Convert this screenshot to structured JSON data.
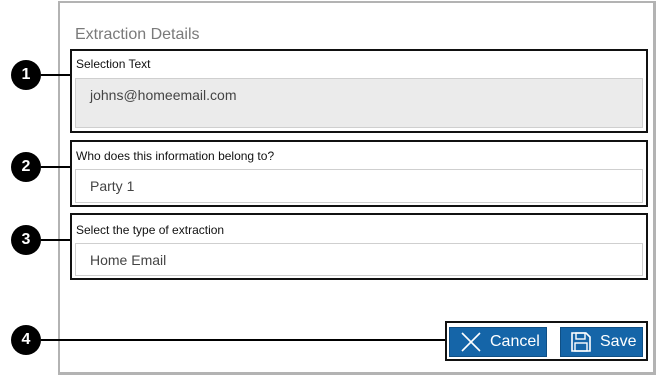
{
  "panel": {
    "title": "Extraction Details"
  },
  "callouts": [
    "1",
    "2",
    "3",
    "4"
  ],
  "selection": {
    "label": "Selection Text",
    "value": "johns@homeemail.com"
  },
  "owner": {
    "label": "Who does this information belong to?",
    "value": "Party 1"
  },
  "extraction_type": {
    "label": "Select the type of extraction",
    "value": "Home Email"
  },
  "actions": {
    "cancel_label": "Cancel",
    "save_label": "Save"
  },
  "colors": {
    "button": "#1565a8",
    "readonly_field": "#ebebeb",
    "callout": "#000000"
  },
  "icons": {
    "cancel": "close-icon",
    "save": "floppy-disk-icon"
  }
}
